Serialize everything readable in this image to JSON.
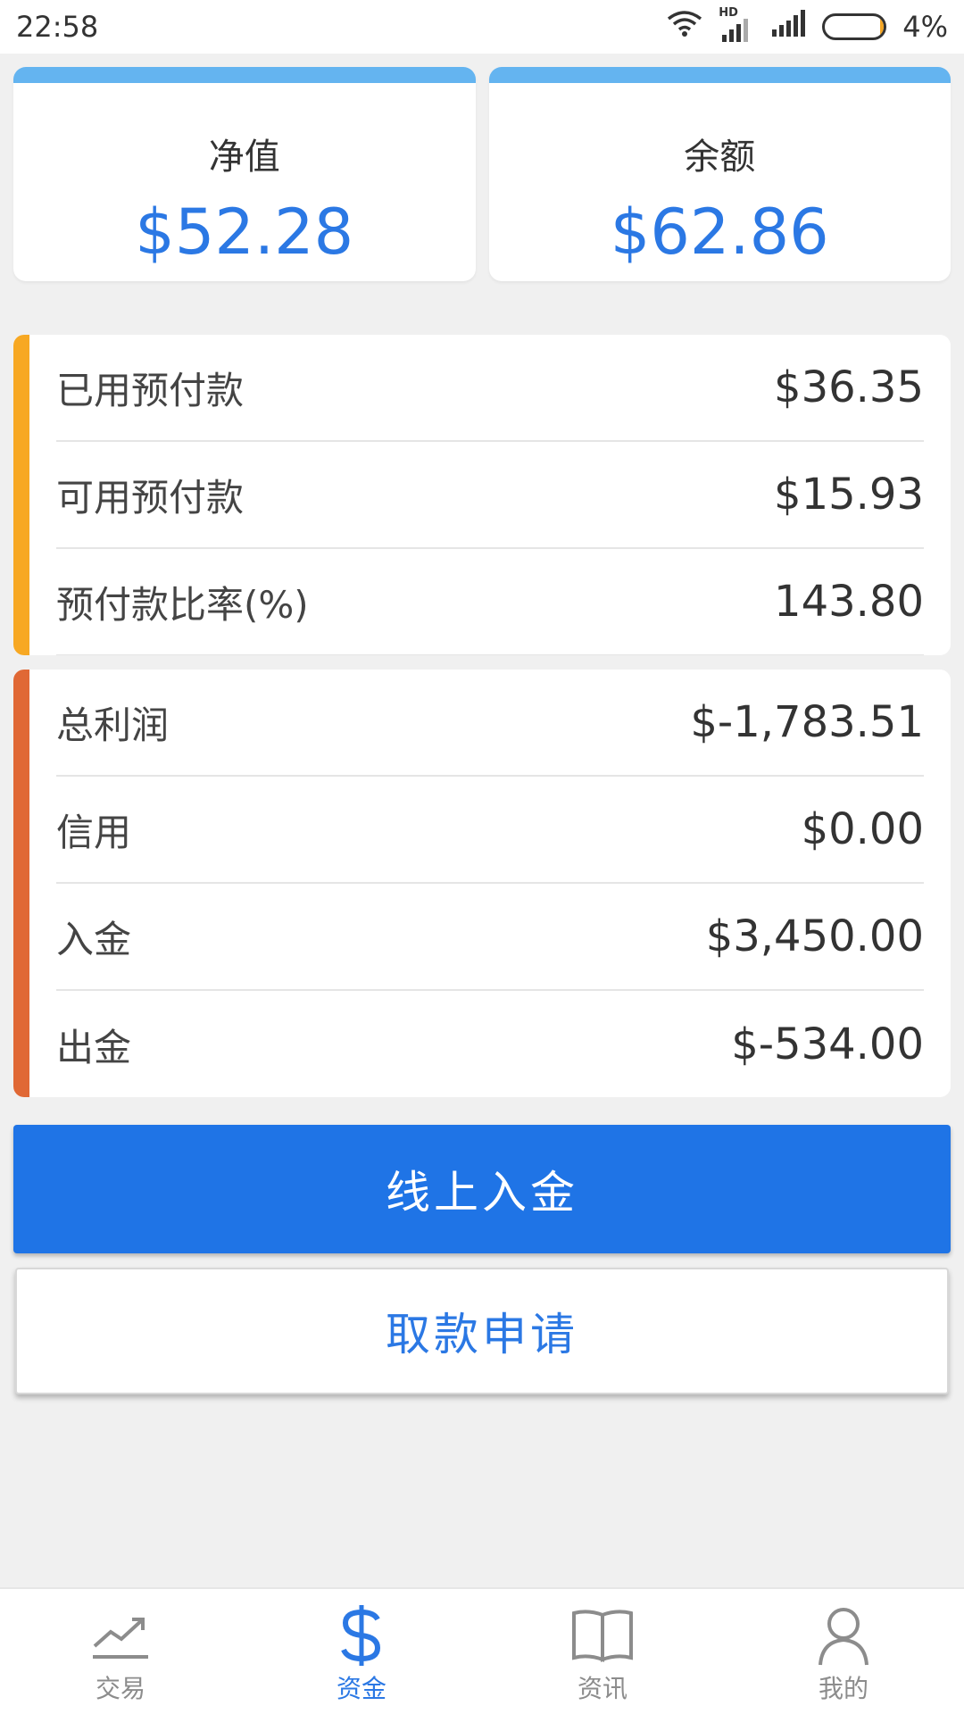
{
  "status_bar": {
    "time": "22:58",
    "battery_text": "4%",
    "battery_level": 0.04,
    "hd_label": "HD"
  },
  "summary": [
    {
      "label": "净值",
      "value": "$52.28"
    },
    {
      "label": "余额",
      "value": "$62.86"
    }
  ],
  "group_one": [
    {
      "label": "已用预付款",
      "value": "$36.35"
    },
    {
      "label": "可用预付款",
      "value": "$15.93"
    },
    {
      "label": "预付款比率(%)",
      "value": "143.80"
    }
  ],
  "group_two": [
    {
      "label": "总利润",
      "value": "$-1,783.51"
    },
    {
      "label": "信用",
      "value": "$0.00"
    },
    {
      "label": "入金",
      "value": "$3,450.00"
    },
    {
      "label": "出金",
      "value": "$-534.00"
    }
  ],
  "buttons": {
    "deposit_online": "线上入金",
    "withdraw_request": "取款申请"
  },
  "tabs": [
    {
      "label": "交易",
      "icon": "trend-chart-icon"
    },
    {
      "label": "资金",
      "icon": "dollar-icon",
      "active": true
    },
    {
      "label": "资讯",
      "icon": "book-icon"
    },
    {
      "label": "我的",
      "icon": "user-icon"
    }
  ],
  "colors": {
    "accent_blue": "#2b78e4",
    "primary_button": "#1f74e6",
    "group_one_accent": "#f7a823",
    "group_two_accent": "#e06835",
    "card_topbar": "#64b4f0"
  }
}
